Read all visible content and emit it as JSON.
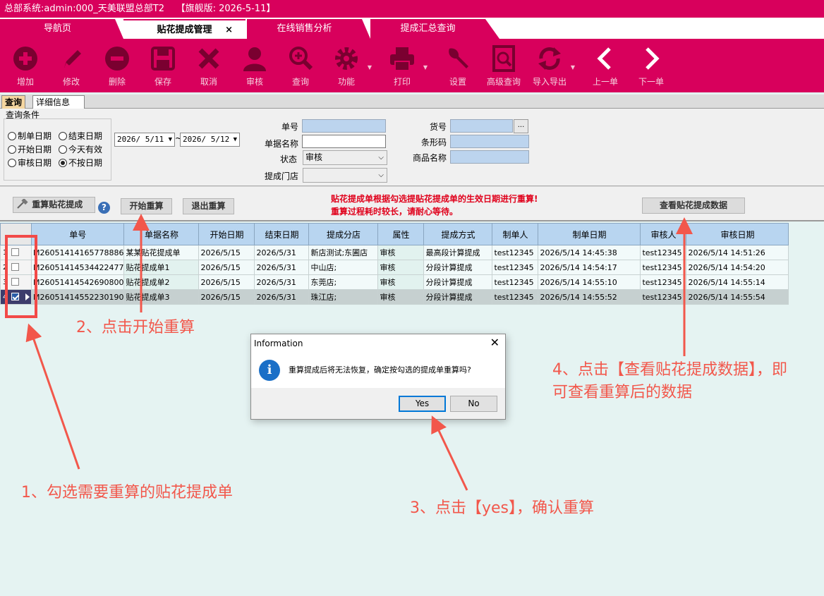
{
  "title_bar": {
    "system": "总部系统:admin:000_天美联盟总部T2",
    "edition": "【旗舰版: 2026-5-11】"
  },
  "tabs": [
    {
      "label": "导航页"
    },
    {
      "label": "贴花提成管理",
      "close": "×"
    },
    {
      "label": "在线销售分析"
    },
    {
      "label": "提成汇总查询"
    }
  ],
  "toolbar": [
    {
      "label": "增加",
      "icon": "add-icon"
    },
    {
      "label": "修改",
      "icon": "edit-icon"
    },
    {
      "label": "删除",
      "icon": "delete-icon"
    },
    {
      "label": "保存",
      "icon": "save-icon"
    },
    {
      "label": "取消",
      "icon": "cancel-icon"
    },
    {
      "label": "审核",
      "icon": "audit-icon"
    },
    {
      "label": "查询",
      "icon": "search-icon"
    },
    {
      "label": "功能",
      "icon": "gear-icon"
    },
    {
      "label": "打印",
      "icon": "print-icon"
    },
    {
      "label": "设置",
      "icon": "wrench-icon"
    },
    {
      "label": "高级查询",
      "icon": "advanced-search-icon"
    },
    {
      "label": "导入导出",
      "icon": "import-export-icon"
    },
    {
      "label": "上一单",
      "icon": "chevron-left-icon"
    },
    {
      "label": "下一单",
      "icon": "chevron-right-icon"
    }
  ],
  "subtabs": {
    "query": "查询",
    "detail": "详细信息"
  },
  "query": {
    "title": "查询条件",
    "radios": [
      {
        "label": "制单日期",
        "checked": false
      },
      {
        "label": "结束日期",
        "checked": false
      },
      {
        "label": "开始日期",
        "checked": false
      },
      {
        "label": "今天有效",
        "checked": false
      },
      {
        "label": "审核日期",
        "checked": false
      },
      {
        "label": "不按日期",
        "checked": true
      }
    ],
    "date_from": "2026/ 5/11",
    "date_sep": "~",
    "date_to": "2026/ 5/12",
    "labels": {
      "doc_no": "单号",
      "doc_name": "单据名称",
      "status": "状态",
      "store": "提成门店",
      "item_no": "货号",
      "barcode": "条形码",
      "product_name": "商品名称"
    },
    "status_value": "审核",
    "dots": "..."
  },
  "actions": {
    "recalc": "重算贴花提成",
    "help": "?",
    "start": "开始重算",
    "exit": "退出重算",
    "notice_line1": "贴花提成单根据勾选提贴花提成单的生效日期进行重算!",
    "notice_line2": "重算过程耗时较长，请耐心等待。",
    "view": "查看贴花提成数据"
  },
  "table": {
    "columns": [
      "单号",
      "单据名称",
      "开始日期",
      "结束日期",
      "提成分店",
      "属性",
      "提成方式",
      "制单人",
      "制单日期",
      "审核人",
      "审核日期"
    ],
    "rows": [
      {
        "num": "1",
        "checked": false,
        "cells": [
          "M26051414165778886",
          "某某贴花提成单",
          "2026/5/15",
          "2026/5/31",
          "新店测试;东圃店",
          "审核",
          "最高段计算提成",
          "test12345",
          "2026/5/14 14:45:38",
          "test12345",
          "2026/5/14 14:51:26"
        ]
      },
      {
        "num": "2",
        "checked": false,
        "cells": [
          "M26051414534422477",
          "贴花提成单1",
          "2026/5/15",
          "2026/5/31",
          "中山店;",
          "审核",
          "分段计算提成",
          "test12345",
          "2026/5/14 14:54:17",
          "test12345",
          "2026/5/14 14:54:20"
        ]
      },
      {
        "num": "3",
        "checked": false,
        "cells": [
          "M26051414542690800",
          "贴花提成单2",
          "2026/5/15",
          "2026/5/31",
          "东莞店;",
          "审核",
          "分段计算提成",
          "test12345",
          "2026/5/14 14:55:10",
          "test12345",
          "2026/5/14 14:55:14"
        ]
      },
      {
        "num": "4",
        "checked": true,
        "cells": [
          "M26051414552230190",
          "贴花提成单3",
          "2026/5/15",
          "2026/5/31",
          "珠江店;",
          "审核",
          "分段计算提成",
          "test12345",
          "2026/5/14 14:55:52",
          "test12345",
          "2026/5/14 14:55:54"
        ]
      }
    ]
  },
  "dialog": {
    "title": "Information",
    "close": "✕",
    "icon": "info-icon",
    "icon_glyph": "i",
    "message": "重算提成后将无法恢复，确定按勾选的提成单重算吗?",
    "yes": "Yes",
    "no": "No"
  },
  "annotations": {
    "step1": "1、勾选需要重算的贴花提成单",
    "step2": "2、点击开始重算",
    "step3": "3、点击【yes】，确认重算",
    "step4_line1": "4、点击【查看贴花提成数据】，即",
    "step4_line2": "可查看重算后的数据"
  },
  "colors": {
    "brand": "#d8005c",
    "annotation": "#f2574b",
    "grid_header": "#b8d5f0",
    "notice": "#e0001b"
  }
}
